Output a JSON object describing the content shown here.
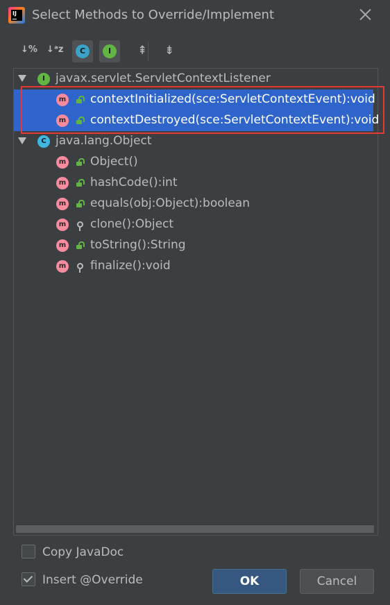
{
  "window": {
    "title": "Select Methods to Override/Implement"
  },
  "toolbar": {
    "sort_by_visibility": "↓%",
    "sort_alpha": "↓ᵃz",
    "show_classes_glyph": "C",
    "show_interfaces_glyph": "I",
    "expand_all": "⇞",
    "collapse_all": "⇟"
  },
  "tree": {
    "groups": [
      {
        "type_glyph": "I",
        "name": "javax.servlet.ServletContextListener",
        "methods": [
          {
            "glyph": "m",
            "access": "public",
            "signature": "contextInitialized(sce:ServletContextEvent):void",
            "selected": true
          },
          {
            "glyph": "m",
            "access": "public",
            "signature": "contextDestroyed(sce:ServletContextEvent):void",
            "selected": true
          }
        ]
      },
      {
        "type_glyph": "C",
        "name": "java.lang.Object",
        "methods": [
          {
            "glyph": "m",
            "access": "public",
            "signature": "Object()"
          },
          {
            "glyph": "m",
            "access": "public",
            "signature": "hashCode():int"
          },
          {
            "glyph": "m",
            "access": "public",
            "signature": "equals(obj:Object):boolean"
          },
          {
            "glyph": "m",
            "access": "protected",
            "signature": "clone():Object"
          },
          {
            "glyph": "m",
            "access": "public",
            "signature": "toString():String"
          },
          {
            "glyph": "m",
            "access": "protected",
            "signature": "finalize():void"
          }
        ]
      }
    ]
  },
  "options": {
    "copy_javadoc": {
      "label": "Copy JavaDoc",
      "checked": false
    },
    "insert_override": {
      "label": "Insert @Override",
      "checked": true
    }
  },
  "buttons": {
    "ok": "OK",
    "cancel": "Cancel"
  },
  "colors": {
    "selection": "#2f65ca",
    "annotation": "#e53935"
  }
}
